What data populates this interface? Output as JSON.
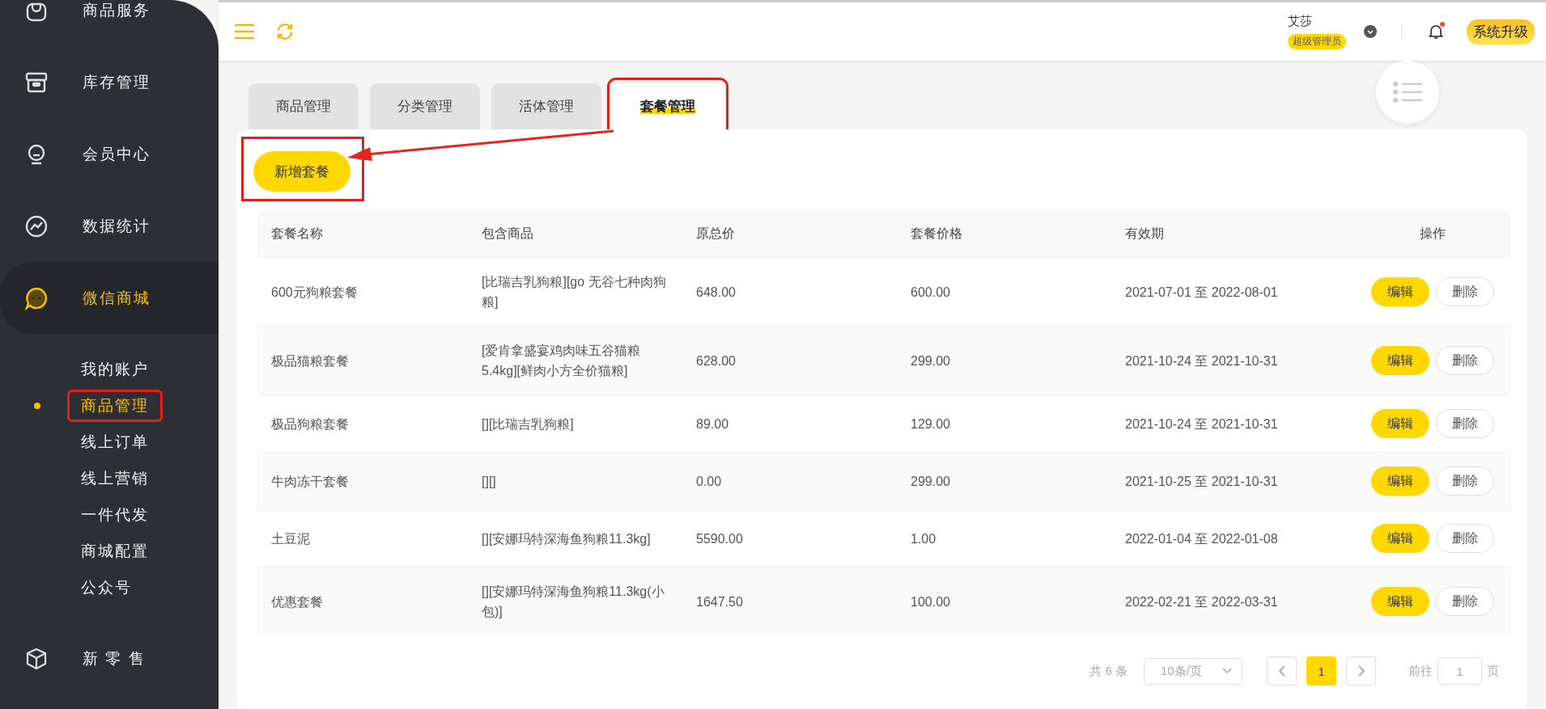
{
  "sidebar": {
    "items": [
      {
        "label": "商品服务",
        "selected": false
      },
      {
        "label": "库存管理",
        "selected": false
      },
      {
        "label": "会员中心",
        "selected": false
      },
      {
        "label": "数据统计",
        "selected": false
      },
      {
        "label": "微信商城",
        "selected": true,
        "children": [
          {
            "label": "我的账户",
            "selected": false,
            "highlighted": false
          },
          {
            "label": "商品管理",
            "selected": true,
            "highlighted": true
          },
          {
            "label": "线上订单",
            "selected": false,
            "highlighted": false
          },
          {
            "label": "线上营销",
            "selected": false,
            "highlighted": false
          },
          {
            "label": "一件代发",
            "selected": false,
            "highlighted": false
          },
          {
            "label": "商城配置",
            "selected": false,
            "highlighted": false
          },
          {
            "label": "公众号",
            "selected": false,
            "highlighted": false
          }
        ]
      },
      {
        "label": "新 零 售",
        "selected": false
      }
    ]
  },
  "header": {
    "user_name": "艾莎",
    "role_badge": "超级管理员",
    "has_notification": true,
    "upgrade_button": "系统升级"
  },
  "tabs": [
    {
      "label": "商品管理",
      "selected": false,
      "highlighted": false
    },
    {
      "label": "分类管理",
      "selected": false,
      "highlighted": false
    },
    {
      "label": "活体管理",
      "selected": false,
      "highlighted": false
    },
    {
      "label": "套餐管理",
      "selected": true,
      "highlighted": true
    }
  ],
  "add_button": {
    "label": "新增套餐",
    "highlighted": true
  },
  "table": {
    "columns": [
      "套餐名称",
      "包含商品",
      "原总价",
      "套餐价格",
      "有效期",
      "操作"
    ],
    "rows": [
      {
        "name": "600元狗粮套餐",
        "products": "[比瑞吉乳狗粮][go 无谷七种肉狗粮]",
        "original_price": "648.00",
        "package_price": "600.00",
        "validity": "2021-07-01 至 2022-08-01",
        "actions": [
          "编辑",
          "删除"
        ]
      },
      {
        "name": "极品猫粮套餐",
        "products": "[爱肯拿盛宴鸡肉味五谷猫粮5.4kg][鲜肉小方全价猫粮]",
        "original_price": "628.00",
        "package_price": "299.00",
        "validity": "2021-10-24 至 2021-10-31",
        "actions": [
          "编辑",
          "删除"
        ]
      },
      {
        "name": "极品狗粮套餐",
        "products": "[][比瑞吉乳狗粮]",
        "original_price": "89.00",
        "package_price": "129.00",
        "validity": "2021-10-24 至 2021-10-31",
        "actions": [
          "编辑",
          "删除"
        ]
      },
      {
        "name": "牛肉冻干套餐",
        "products": "[][]",
        "original_price": "0.00",
        "package_price": "299.00",
        "validity": "2021-10-25 至 2021-10-31",
        "actions": [
          "编辑",
          "删除"
        ]
      },
      {
        "name": "土豆泥",
        "products": "[][安娜玛特深海鱼狗粮11.3kg]",
        "original_price": "5590.00",
        "package_price": "1.00",
        "validity": "2022-01-04 至 2022-01-08",
        "actions": [
          "编辑",
          "删除"
        ]
      },
      {
        "name": "优惠套餐",
        "products": "[][安娜玛特深海鱼狗粮11.3kg(小包)]",
        "original_price": "1647.50",
        "package_price": "100.00",
        "validity": "2022-02-21 至 2022-03-31",
        "actions": [
          "编辑",
          "删除"
        ]
      }
    ]
  },
  "pagination": {
    "total": "共 6 条",
    "page_size": "10条/页",
    "pages": [
      {
        "label": "1",
        "selected": true
      }
    ],
    "goto_label": "前往",
    "goto_value": "1",
    "page_unit": "页"
  }
}
